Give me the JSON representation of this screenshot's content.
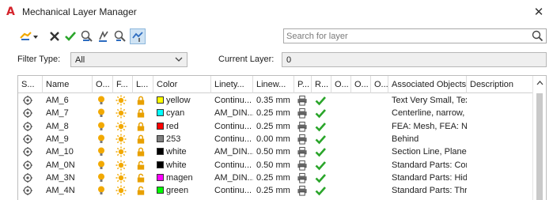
{
  "window": {
    "title": "Mechanical Layer Manager",
    "close_glyph": "✕"
  },
  "toolbar": {
    "buttons": [
      {
        "name": "new-layer-button",
        "icon": "new-layer-icon"
      },
      {
        "name": "delete-layer-button",
        "icon": "delete-icon"
      },
      {
        "name": "set-current-button",
        "icon": "checkmark-icon"
      },
      {
        "name": "layer-tool-1-button",
        "icon": "layer-tool-icon"
      },
      {
        "name": "layer-tool-2-button",
        "icon": "layer-tool-icon"
      },
      {
        "name": "layer-tool-3-button",
        "icon": "layer-tool-icon"
      },
      {
        "name": "layer-tool-4-button",
        "icon": "layer-tool-icon"
      }
    ]
  },
  "search": {
    "placeholder": "Search for layer",
    "value": ""
  },
  "filter": {
    "label": "Filter Type:",
    "value": "All"
  },
  "current_layer": {
    "label": "Current Layer:",
    "value": "0"
  },
  "table": {
    "columns": [
      "S...",
      "Name",
      "O...",
      "F...",
      "L...",
      "Color",
      "Linety...",
      "Linew...",
      "P...",
      "R...",
      "O...",
      "O...",
      "O...",
      "Associated Objects",
      "Description"
    ],
    "rows": [
      {
        "name": "AM_6",
        "color_name": "yellow",
        "color_hex": "#ffff00",
        "linetype": "Continu...",
        "lineweight": "0.35 mm",
        "associated": "Text Very Small, Text S...",
        "locked": true
      },
      {
        "name": "AM_7",
        "color_name": "cyan",
        "color_hex": "#00ffff",
        "linetype": "AM_DIN...",
        "lineweight": "0.25 mm",
        "associated": "Centerline, narrow, Ce...",
        "locked": true
      },
      {
        "name": "AM_8",
        "color_name": "red",
        "color_hex": "#ff0000",
        "linetype": "Continu...",
        "lineweight": "0.25 mm",
        "associated": "FEA: Mesh, FEA: Numb...",
        "locked": true
      },
      {
        "name": "AM_9",
        "color_name": "253",
        "color_hex": "#808080",
        "linetype": "Continu...",
        "lineweight": "0.00 mm",
        "associated": "Behind",
        "locked": true
      },
      {
        "name": "AM_10",
        "color_name": "white",
        "color_hex": "#000000",
        "linetype": "AM_DIN...",
        "lineweight": "0.50 mm",
        "associated": "Section Line, Plane Line",
        "locked": true
      },
      {
        "name": "AM_0N",
        "color_name": "white",
        "color_hex": "#000000",
        "linetype": "Continu...",
        "lineweight": "0.50 mm",
        "associated": "Standard Parts: Conto...",
        "locked": false
      },
      {
        "name": "AM_3N",
        "color_name": "magen",
        "color_hex": "#ff00ff",
        "linetype": "AM_DIN...",
        "lineweight": "0.25 mm",
        "associated": "Standard Parts: Hidden...",
        "locked": false
      },
      {
        "name": "AM_4N",
        "color_name": "green",
        "color_hex": "#00ff00",
        "linetype": "Continu...",
        "lineweight": "0.25 mm",
        "associated": "Standard Parts: Thread...",
        "locked": false
      }
    ]
  },
  "colors": {
    "accent": "#d4232b",
    "check": "#2aa52a",
    "bulb": "#f2a900",
    "sun": "#f2a900",
    "lock": "#e8a000"
  }
}
